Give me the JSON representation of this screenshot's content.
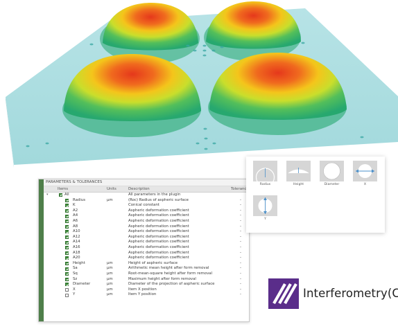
{
  "panel": {
    "title": "PARAMETERS & TOLERANCES",
    "columns": {
      "items": "Items",
      "units": "Units",
      "description": "Description",
      "tolerance": "Tolerance"
    },
    "rows": [
      {
        "name": "All",
        "units": "",
        "desc": "All parameters in the plugin",
        "tol": "",
        "checked": true,
        "level": 0
      },
      {
        "name": "Radius",
        "units": "μm",
        "desc": "(Roc) Radius of aspheric surface",
        "tol": "-",
        "checked": true,
        "level": 1
      },
      {
        "name": "K",
        "units": "",
        "desc": "Conical constant",
        "tol": "-",
        "checked": true,
        "level": 1
      },
      {
        "name": "A2",
        "units": "",
        "desc": "Aspheric deformation coefficient",
        "tol": "-",
        "checked": true,
        "level": 1
      },
      {
        "name": "A4",
        "units": "",
        "desc": "Aspheric deformation coefficient",
        "tol": "-",
        "checked": true,
        "level": 1
      },
      {
        "name": "A6",
        "units": "",
        "desc": "Aspheric deformation coefficient",
        "tol": "-",
        "checked": true,
        "level": 1
      },
      {
        "name": "A8",
        "units": "",
        "desc": "Aspheric deformation coefficient",
        "tol": "-",
        "checked": true,
        "level": 1
      },
      {
        "name": "A10",
        "units": "",
        "desc": "Aspheric deformation coefficient",
        "tol": "-",
        "checked": true,
        "level": 1
      },
      {
        "name": "A12",
        "units": "",
        "desc": "Aspheric deformation coefficient",
        "tol": "-",
        "checked": true,
        "level": 1
      },
      {
        "name": "A14",
        "units": "",
        "desc": "Aspheric deformation coefficient",
        "tol": "-",
        "checked": true,
        "level": 1
      },
      {
        "name": "A16",
        "units": "",
        "desc": "Aspheric deformation coefficient",
        "tol": "-",
        "checked": true,
        "level": 1
      },
      {
        "name": "A18",
        "units": "",
        "desc": "Aspheric deformation coefficient",
        "tol": "-",
        "checked": true,
        "level": 1
      },
      {
        "name": "A20",
        "units": "",
        "desc": "Aspheric deformation coefficient",
        "tol": "-",
        "checked": true,
        "level": 1
      },
      {
        "name": "Height",
        "units": "μm",
        "desc": "Height of aspheric surface",
        "tol": "-",
        "checked": true,
        "level": 1
      },
      {
        "name": "Sa",
        "units": "μm",
        "desc": "Arithmetic mean height after form removal",
        "tol": "-",
        "checked": true,
        "level": 1
      },
      {
        "name": "Sq",
        "units": "μm",
        "desc": "Root-mean-square height after form removal",
        "tol": "-",
        "checked": true,
        "level": 1
      },
      {
        "name": "Sz",
        "units": "μm",
        "desc": "Maximum height after form removal",
        "tol": "-",
        "checked": true,
        "level": 1
      },
      {
        "name": "Diameter",
        "units": "μm",
        "desc": "Diameter of the projection of aspheric surface",
        "tol": "-",
        "checked": true,
        "level": 1
      },
      {
        "name": "X",
        "units": "μm",
        "desc": "Item X position",
        "tol": "-",
        "checked": false,
        "level": 1
      },
      {
        "name": "Y",
        "units": "μm",
        "desc": "Item Y position",
        "tol": "-",
        "checked": false,
        "level": 1
      }
    ]
  },
  "shapes": [
    {
      "label": "Radius",
      "icon": "radius-icon"
    },
    {
      "label": "Height",
      "icon": "height-icon"
    },
    {
      "label": "Diameter",
      "icon": "diameter-icon"
    },
    {
      "label": "X",
      "icon": "x-width-icon"
    },
    {
      "label": "Y",
      "icon": "y-height-icon"
    }
  ],
  "brand": {
    "text": "Interferometry(CSI)",
    "logo_color": "#5a2d8a"
  },
  "colors": {
    "plane": "#a9dde0",
    "peak": "#e8431c",
    "mid": "#f2d21a",
    "base": "#3eb86a",
    "check_green": "#3f8f3a"
  }
}
